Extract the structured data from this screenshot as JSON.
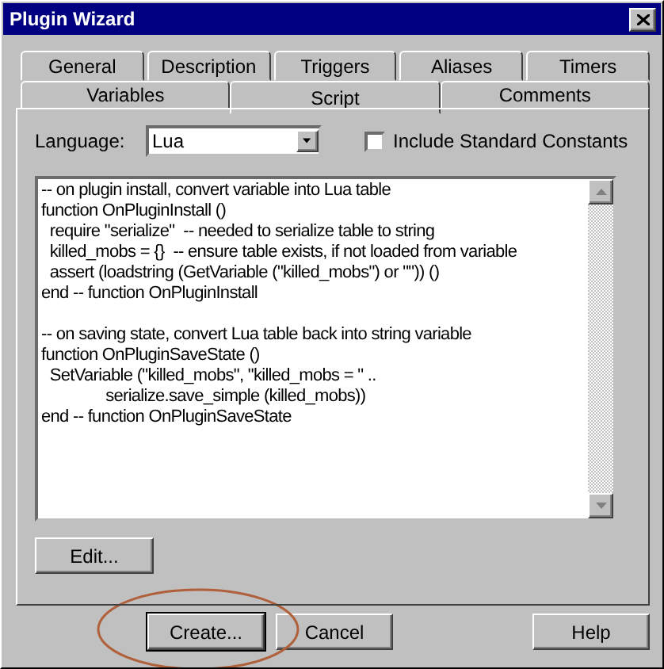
{
  "window": {
    "title": "Plugin Wizard"
  },
  "tab_rows": [
    [
      {
        "label": "General",
        "selected": false
      },
      {
        "label": "Description",
        "selected": false
      },
      {
        "label": "Triggers",
        "selected": false
      },
      {
        "label": "Aliases",
        "selected": false
      },
      {
        "label": "Timers",
        "selected": false
      }
    ],
    [
      {
        "label": "Variables",
        "selected": false
      },
      {
        "label": "Script",
        "selected": true
      },
      {
        "label": "Comments",
        "selected": false
      }
    ]
  ],
  "language": {
    "label": "Language:",
    "value": "Lua"
  },
  "include_constants": {
    "label": "Include Standard Constants",
    "checked": false
  },
  "script_blocks": [
    [
      "-- on plugin install, convert variable into Lua table",
      "function OnPluginInstall ()",
      "  require \"serialize\"  -- needed to serialize table to string",
      "  killed_mobs = {}  -- ensure table exists, if not loaded from variable",
      "  assert (loadstring (GetVariable (\"killed_mobs\") or \"\")) ()",
      "end -- function OnPluginInstall"
    ],
    [
      "-- on saving state, convert Lua table back into string variable",
      "function OnPluginSaveState ()",
      "  SetVariable (\"killed_mobs\", \"killed_mobs = \" ..",
      "               serialize.save_simple (killed_mobs))",
      "end -- function OnPluginSaveState"
    ]
  ],
  "edit_button": "Edit...",
  "buttons": [
    {
      "label": "Create...",
      "default": true
    },
    {
      "label": "Cancel",
      "default": false
    },
    {
      "label": "Help",
      "default": false
    }
  ]
}
